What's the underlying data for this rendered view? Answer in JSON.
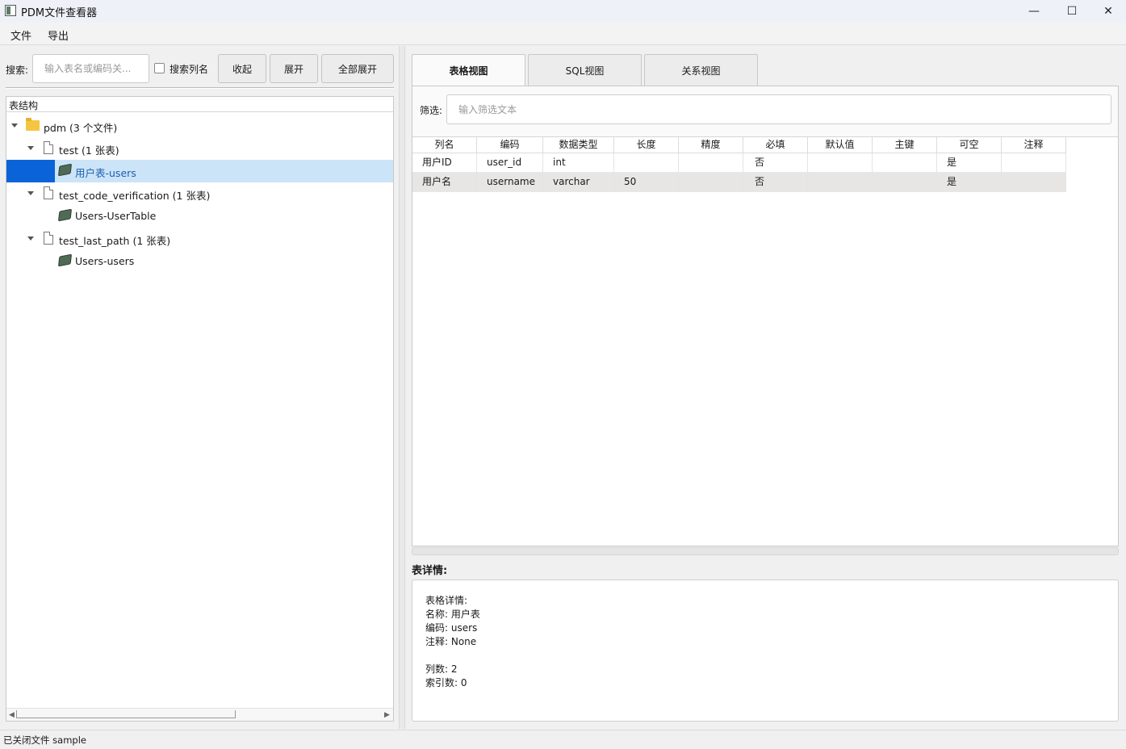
{
  "window": {
    "title": "PDM文件查看器",
    "minimize": "—",
    "maximize": "☐",
    "close": "✕"
  },
  "menu": [
    "文件",
    "导出"
  ],
  "search": {
    "label": "搜索:",
    "placeholder": "输入表名或编码关...",
    "checkbox_label": "搜索列名",
    "checked": false,
    "buttons": [
      "收起",
      "展开",
      "全部展开"
    ]
  },
  "tree": {
    "header": "表结构",
    "root": "pdm (3 个文件)",
    "files": [
      {
        "label": "test (1 张表)",
        "tables": [
          "用户表-users"
        ]
      },
      {
        "label": "test_code_verification (1 张表)",
        "tables": [
          "Users-UserTable"
        ]
      },
      {
        "label": "test_last_path (1 张表)",
        "tables": [
          "Users-users"
        ]
      }
    ],
    "selected": "用户表-users"
  },
  "tabs": [
    "表格视图",
    "SQL视图",
    "关系视图"
  ],
  "active_tab": "表格视图",
  "filter": {
    "label": "筛选:",
    "placeholder": "输入筛选文本"
  },
  "grid": {
    "columns": [
      "列名",
      "编码",
      "数据类型",
      "长度",
      "精度",
      "必填",
      "默认值",
      "主键",
      "可空",
      "注释"
    ],
    "rows": [
      [
        "用户ID",
        "user_id",
        "int",
        "",
        "",
        "否",
        "",
        "",
        "是",
        ""
      ],
      [
        "用户名",
        "username",
        "varchar",
        "50",
        "",
        "否",
        "",
        "",
        "是",
        ""
      ]
    ]
  },
  "details": {
    "label": "表详情:",
    "lines": [
      "表格详情:",
      "名称: 用户表",
      "编码: users",
      "注释: None",
      "",
      "列数: 2",
      "索引数: 0"
    ]
  },
  "status": "已关闭文件 sample",
  "colors": {
    "selection_bg": "#cce4f7",
    "selection_accent": "#0a64d8",
    "folder": "#f5c542"
  }
}
